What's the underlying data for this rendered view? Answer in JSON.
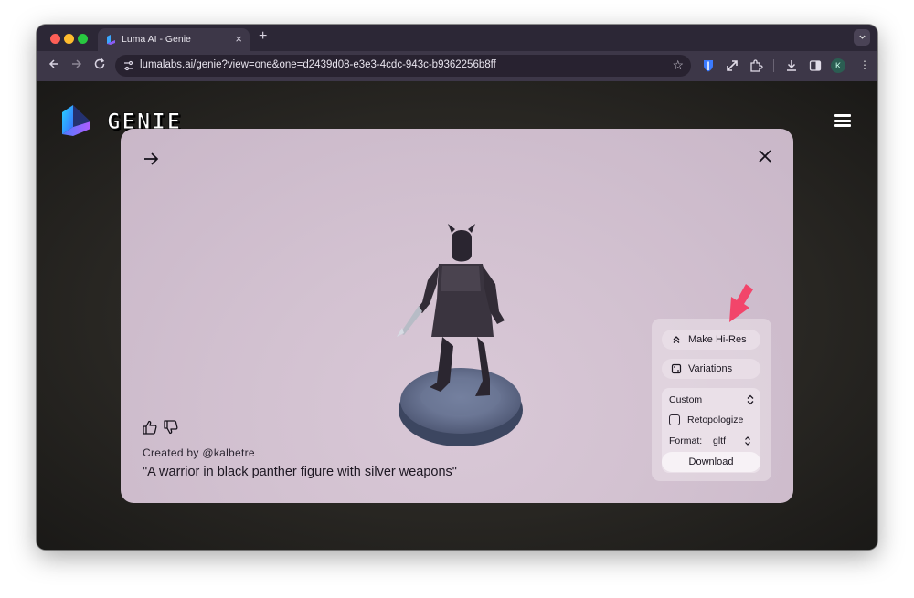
{
  "browser": {
    "tab_title": "Luma AI - Genie",
    "tab_close": "×",
    "new_tab": "+",
    "url": "lumalabs.ai/genie?view=one&one=d2439d08-e3e3-4cdc-943c-b9362256b8ff",
    "profile_initial": "K"
  },
  "site": {
    "brand": "GENIE"
  },
  "viewer": {
    "creator": "Created by @kalbetre",
    "prompt": "\"A warrior in black panther figure with silver weapons\""
  },
  "panel": {
    "make_hires_label": "Make Hi-Res",
    "variations_label": "Variations",
    "topology_select": "Custom",
    "retopologize_label": "Retopologize",
    "retopologize_checked": false,
    "format_label": "Format:",
    "format_value": "gltf",
    "download_label": "Download"
  },
  "colors": {
    "accent_arrow": "#f2456a",
    "card_bg": "#d3c2d1"
  }
}
